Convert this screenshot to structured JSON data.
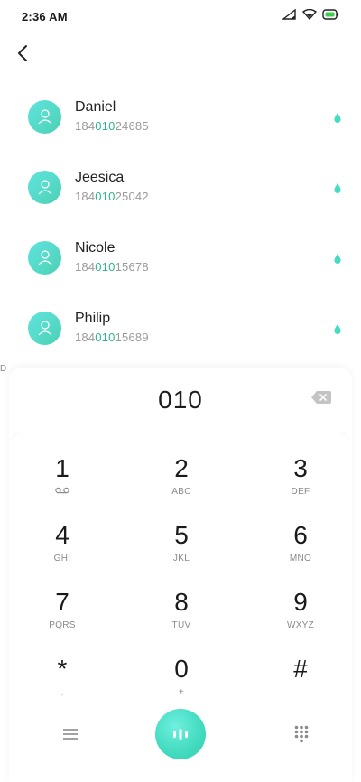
{
  "status_bar": {
    "time": "2:36 AM",
    "icons": [
      "signal-icon",
      "wifi-icon",
      "battery-icon"
    ]
  },
  "contacts": [
    {
      "name": "Daniel",
      "number_prefix": "184",
      "number_match": "010",
      "number_suffix": "24685"
    },
    {
      "name": "Jeesica",
      "number_prefix": "184",
      "number_match": "010",
      "number_suffix": "25042"
    },
    {
      "name": "Nicole",
      "number_prefix": "184",
      "number_match": "010",
      "number_suffix": "15678"
    },
    {
      "name": "Philip",
      "number_prefix": "184",
      "number_match": "010",
      "number_suffix": "15689"
    }
  ],
  "side_index_letter": "D",
  "dialer": {
    "input_value": "010",
    "keys": [
      {
        "digit": "1",
        "letters": ""
      },
      {
        "digit": "2",
        "letters": "ABC"
      },
      {
        "digit": "3",
        "letters": "DEF"
      },
      {
        "digit": "4",
        "letters": "GHI"
      },
      {
        "digit": "5",
        "letters": "JKL"
      },
      {
        "digit": "6",
        "letters": "MNO"
      },
      {
        "digit": "7",
        "letters": "PQRS"
      },
      {
        "digit": "8",
        "letters": "TUV"
      },
      {
        "digit": "9",
        "letters": "WXYZ"
      },
      {
        "digit": "*",
        "letters": ","
      },
      {
        "digit": "0",
        "letters": "+"
      },
      {
        "digit": "#",
        "letters": ""
      }
    ]
  },
  "colors": {
    "accent": "#45dcc2",
    "match_highlight": "#2bb58c",
    "secondary_text": "#9a9a9a"
  }
}
